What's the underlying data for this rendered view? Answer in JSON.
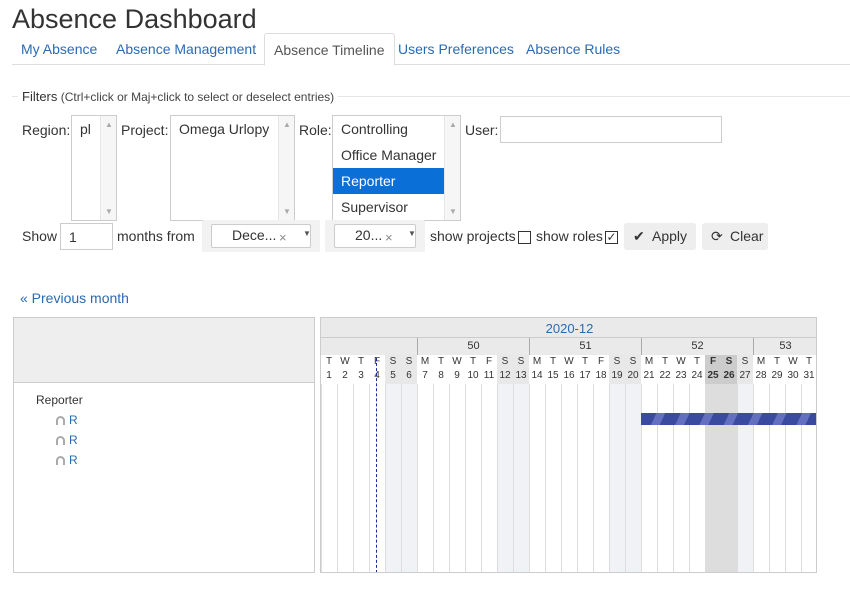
{
  "title": "Absence Dashboard",
  "tabs": [
    {
      "label": "My Absence"
    },
    {
      "label": "Absence Management"
    },
    {
      "label": "Absence Timeline"
    },
    {
      "label": "Users Preferences"
    },
    {
      "label": "Absence Rules"
    }
  ],
  "filters": {
    "legend": "Filters",
    "hint": "(Ctrl+click or Maj+click to select or deselect entries)",
    "region_label": "Region:",
    "region_options": [
      "pl"
    ],
    "project_label": "Project:",
    "project_options": [
      "Omega Urlopy"
    ],
    "role_label": "Role:",
    "role_options": [
      "Controlling",
      "Office Manager",
      "Reporter",
      "Supervisor"
    ],
    "role_selected": "Reporter",
    "user_label": "User:",
    "user_value": "",
    "show_label": "Show",
    "months_value": "1",
    "months_from_label": "months from",
    "month_select": "Dece...",
    "year_select": "20...",
    "show_projects_label": "show projects",
    "show_projects_checked": false,
    "show_roles_label": "show roles",
    "show_roles_checked": true,
    "apply_label": "Apply",
    "clear_label": "Clear"
  },
  "previous_month_label": "« Previous month",
  "timeline": {
    "month_label": "2020-12",
    "weeks": [
      "50",
      "51",
      "52",
      "53"
    ],
    "days": [
      {
        "d": "T",
        "n": "1"
      },
      {
        "d": "W",
        "n": "2"
      },
      {
        "d": "T",
        "n": "3"
      },
      {
        "d": "F",
        "n": "4"
      },
      {
        "d": "S",
        "n": "5"
      },
      {
        "d": "S",
        "n": "6"
      },
      {
        "d": "M",
        "n": "7"
      },
      {
        "d": "T",
        "n": "8"
      },
      {
        "d": "W",
        "n": "9"
      },
      {
        "d": "T",
        "n": "10"
      },
      {
        "d": "F",
        "n": "11"
      },
      {
        "d": "S",
        "n": "12"
      },
      {
        "d": "S",
        "n": "13"
      },
      {
        "d": "M",
        "n": "14"
      },
      {
        "d": "T",
        "n": "15"
      },
      {
        "d": "W",
        "n": "16"
      },
      {
        "d": "T",
        "n": "17"
      },
      {
        "d": "F",
        "n": "18"
      },
      {
        "d": "S",
        "n": "19"
      },
      {
        "d": "S",
        "n": "20"
      },
      {
        "d": "M",
        "n": "21"
      },
      {
        "d": "T",
        "n": "22"
      },
      {
        "d": "W",
        "n": "23"
      },
      {
        "d": "T",
        "n": "24"
      },
      {
        "d": "F",
        "n": "25"
      },
      {
        "d": "S",
        "n": "26"
      },
      {
        "d": "S",
        "n": "27"
      },
      {
        "d": "M",
        "n": "28"
      },
      {
        "d": "T",
        "n": "29"
      },
      {
        "d": "W",
        "n": "30"
      },
      {
        "d": "T",
        "n": "31"
      }
    ],
    "group_label": "Reporter",
    "users": [
      "R",
      "R",
      "R"
    ],
    "absence_from": "21",
    "absence_to": "31",
    "colors": {
      "bar": "#3a4a9e",
      "link": "#2a6ab2",
      "selected": "#0a6fd6"
    }
  }
}
